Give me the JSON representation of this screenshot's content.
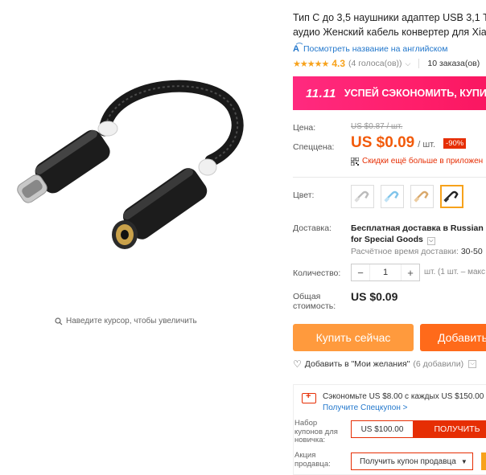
{
  "gallery": {
    "zoom_hint": "Наведите курсор, чтобы увеличить"
  },
  "product": {
    "title_line1": "Тип С до 3,5 наушники адаптер USB 3,1 Т",
    "title_line2": "аудио Женский кабель конвертер для Xia",
    "translate_link": "Посмотреть название на английском",
    "rating": "4.3",
    "votes": "(4 голоса(ов))",
    "orders": "10 заказа(ов)"
  },
  "promo": {
    "badge": "11.11",
    "text": "УСПЕЙ СЭКОНОМИТЬ, КУПИ С"
  },
  "price": {
    "old_label": "Цена:",
    "old_value": "US $0.87 / шт.",
    "now_label": "Спеццена:",
    "now_value": "US $0.09",
    "unit": "/ шт.",
    "discount": "-90%",
    "app_promo": "Скидки ещё больше в приложен"
  },
  "color": {
    "label": "Цвет:",
    "swatches": [
      "silver-adapter",
      "blue-adapter",
      "gold-adapter",
      "black-adapter"
    ],
    "selected_index": 3
  },
  "shipping": {
    "label": "Доставка:",
    "title_line1": "Бесплатная доставка в Russian Fe",
    "title_line2": "for Special Goods",
    "eta_label": "Расчётное время доставки:",
    "eta_value": "30-50"
  },
  "quantity": {
    "label": "Количество:",
    "value": "1",
    "minus": "−",
    "plus": "+",
    "note": "шт. (1 шт. – макс"
  },
  "total": {
    "label_line1": "Общая",
    "label_line2": "стоимость:",
    "value": "US $0.09"
  },
  "actions": {
    "buy_now": "Купить сейчас",
    "add_to_cart": "Добавить",
    "wishlist": "Добавить в \"Мои желания\"",
    "wishlist_count": "(6 добавили)"
  },
  "coupons": {
    "save_text": "Сэкономьте US $8.00 с каждых US $150.00",
    "get_coupon": "Получите Спецкупон >",
    "newbie_label": "Набор купонов для новичка:",
    "newbie_value": "US $100.00",
    "newbie_button": "ПОЛУЧИТЬ",
    "seller_label": "Акция продавца:",
    "seller_button": "Получить купон продавца"
  },
  "colors": {
    "accent_orange": "#f25a0a",
    "buy_now": "#ff9a3d",
    "add_cart": "#ff6a1a",
    "promo_pink": "#ff2a7f",
    "link_blue": "#2277cc",
    "star": "#f7a21b",
    "red": "#e62e04"
  }
}
